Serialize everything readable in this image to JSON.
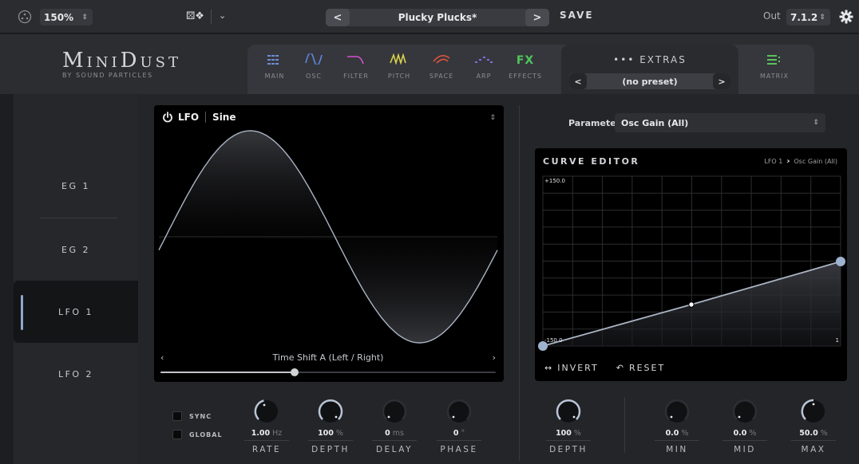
{
  "topbar": {
    "zoom": "150%",
    "preset_name": "Plucky Plucks*",
    "prev_arrow": "<",
    "next_arrow": ">",
    "save": "SAVE",
    "out_label": "Out",
    "out_value": "7.1.2"
  },
  "header": {
    "logo": "MiniDust",
    "logo_sub": "BY SOUND PARTICLES",
    "tabs": [
      {
        "label": "MAIN",
        "icon": "grid-icon",
        "color": "#6f8fd6"
      },
      {
        "label": "OSC",
        "icon": "sine-wave-icon",
        "color": "#5e86e0"
      },
      {
        "label": "FILTER",
        "icon": "filter-curve-icon",
        "color": "#d44fd0"
      },
      {
        "label": "PITCH",
        "icon": "pitch-wave-icon",
        "color": "#d6d24a"
      },
      {
        "label": "SPACE",
        "icon": "space-curve-icon",
        "color": "#e0553e"
      },
      {
        "label": "ARP",
        "icon": "arp-steps-icon",
        "color": "#7b6fe0"
      },
      {
        "label": "EFFECTS",
        "icon": "FX",
        "color": "#4fc65a"
      },
      {
        "label": "MATRIX",
        "icon": "matrix-icon",
        "color": "#5ac35a"
      }
    ],
    "extras_title": "••• EXTRAS",
    "extras_preset": "(no preset)"
  },
  "sidebar": {
    "items": [
      "EG 1",
      "EG 2",
      "LFO 1",
      "LFO 2"
    ],
    "active": "LFO 1"
  },
  "lfo": {
    "label": "LFO",
    "shape": "Sine",
    "shift_label": "Time Shift A (Left / Right)",
    "shift_value": 0.4
  },
  "lfo_knobs": {
    "sync": "SYNC",
    "global": "GLOBAL",
    "rate": {
      "value": "1.00",
      "unit": "Hz",
      "label": "RATE"
    },
    "depth": {
      "value": "100",
      "unit": "%",
      "label": "DEPTH"
    },
    "delay": {
      "value": "0",
      "unit": "ms",
      "label": "DELAY"
    },
    "phase": {
      "value": "0",
      "unit": "°",
      "label": "PHASE"
    }
  },
  "parameter": {
    "label": "Parameter",
    "value": "Osc Gain (All)"
  },
  "curve_editor": {
    "title": "CURVE EDITOR",
    "breadcrumb_from": "LFO 1",
    "breadcrumb_to": "Osc Gain (All)",
    "y_max": "+150.0",
    "y_min": "-150.0",
    "x_max": "1",
    "invert": "INVERT",
    "reset": "RESET"
  },
  "mod_knobs": {
    "depth": {
      "value": "100",
      "unit": "%",
      "label": "DEPTH"
    },
    "min": {
      "value": "0.0",
      "unit": "%",
      "label": "MIN"
    },
    "mid": {
      "value": "0.0",
      "unit": "%",
      "label": "MID"
    },
    "max": {
      "value": "50.0",
      "unit": "%",
      "label": "MAX"
    }
  },
  "colors": {
    "accent": "#8fa7c9",
    "panel": "#000000",
    "background": "#242528"
  }
}
